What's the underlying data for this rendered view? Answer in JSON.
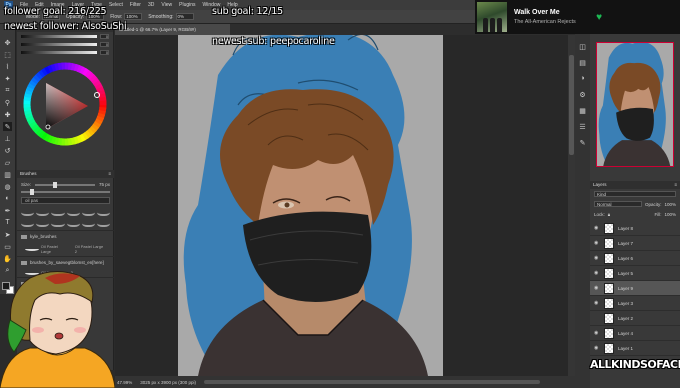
{
  "overlay": {
    "follower_goal": "follower goal: 216/225",
    "sub_goal": "sub goal: 12/15",
    "newest_follower": "newest follower: AlsoSuShi",
    "newest_sub": "newest sub: peepocaroline",
    "watermark": "ALLKINDSOFACE"
  },
  "now_playing": {
    "title": "Walk Over Me",
    "artist": "The All-American Rejects",
    "heart_icon": "heart-icon",
    "accent": "#1db954"
  },
  "photoshop": {
    "logo": "Ps",
    "menu": [
      "File",
      "Edit",
      "Image",
      "Layer",
      "Type",
      "Select",
      "Filter",
      "3D",
      "View",
      "Plugins",
      "Window",
      "Help"
    ],
    "options": {
      "mode_label": "Mode:",
      "mode_value": "Normal",
      "opacity_label": "Opacity:",
      "opacity_value": "100%",
      "flow_label": "Flow:",
      "flow_value": "100%",
      "smoothing_label": "Smoothing:",
      "smoothing_value": "0%"
    },
    "document_tab": "Untitled-1 @ 66.7% (Layer 9, RGB/8#)",
    "color_panel": {
      "title": "Color",
      "values": [
        "0",
        "0",
        "0"
      ]
    },
    "brushes_panel": {
      "title": "Brushes",
      "size_label": "Size:",
      "size_value": "75 px",
      "search": "oil pas",
      "folders": [
        "kyle_brushes",
        "brushes_by_saevegtblomst_en[here]",
        "oil_pastel_pack"
      ],
      "items": [
        "Oil Pastel Large",
        "Oil Pastel Large 2"
      ],
      "items2": [
        "Oil Pastel Large 3",
        "Oil Pastel Large 4"
      ]
    },
    "status": {
      "zoom": "47.99%",
      "size": "3025 px x 3900 px (300 ppi)"
    },
    "layers_panel": {
      "title": "Layers",
      "kind_label": "Kind",
      "blend_mode": "Normal",
      "opacity_label": "Opacity:",
      "opacity_value": "100%",
      "lock_label": "Lock:",
      "fill_label": "Fill:",
      "fill_value": "100%",
      "layers": [
        {
          "name": "Layer 8",
          "visible": true,
          "active": false
        },
        {
          "name": "Layer 7",
          "visible": true,
          "active": false
        },
        {
          "name": "Layer 6",
          "visible": true,
          "active": false
        },
        {
          "name": "Layer 5",
          "visible": true,
          "active": false
        },
        {
          "name": "Layer 9",
          "visible": true,
          "active": true
        },
        {
          "name": "Layer 3",
          "visible": true,
          "active": false
        },
        {
          "name": "Layer 2",
          "visible": false,
          "active": false
        },
        {
          "name": "Layer 4",
          "visible": true,
          "active": false
        },
        {
          "name": "Layer 1",
          "visible": true,
          "active": false
        }
      ]
    }
  },
  "colors": {
    "hood_blue": "#3a7fb5",
    "hair_brown": "#7a4a26",
    "mask_black": "#1f1f1f",
    "skin": "#b68a6a"
  }
}
